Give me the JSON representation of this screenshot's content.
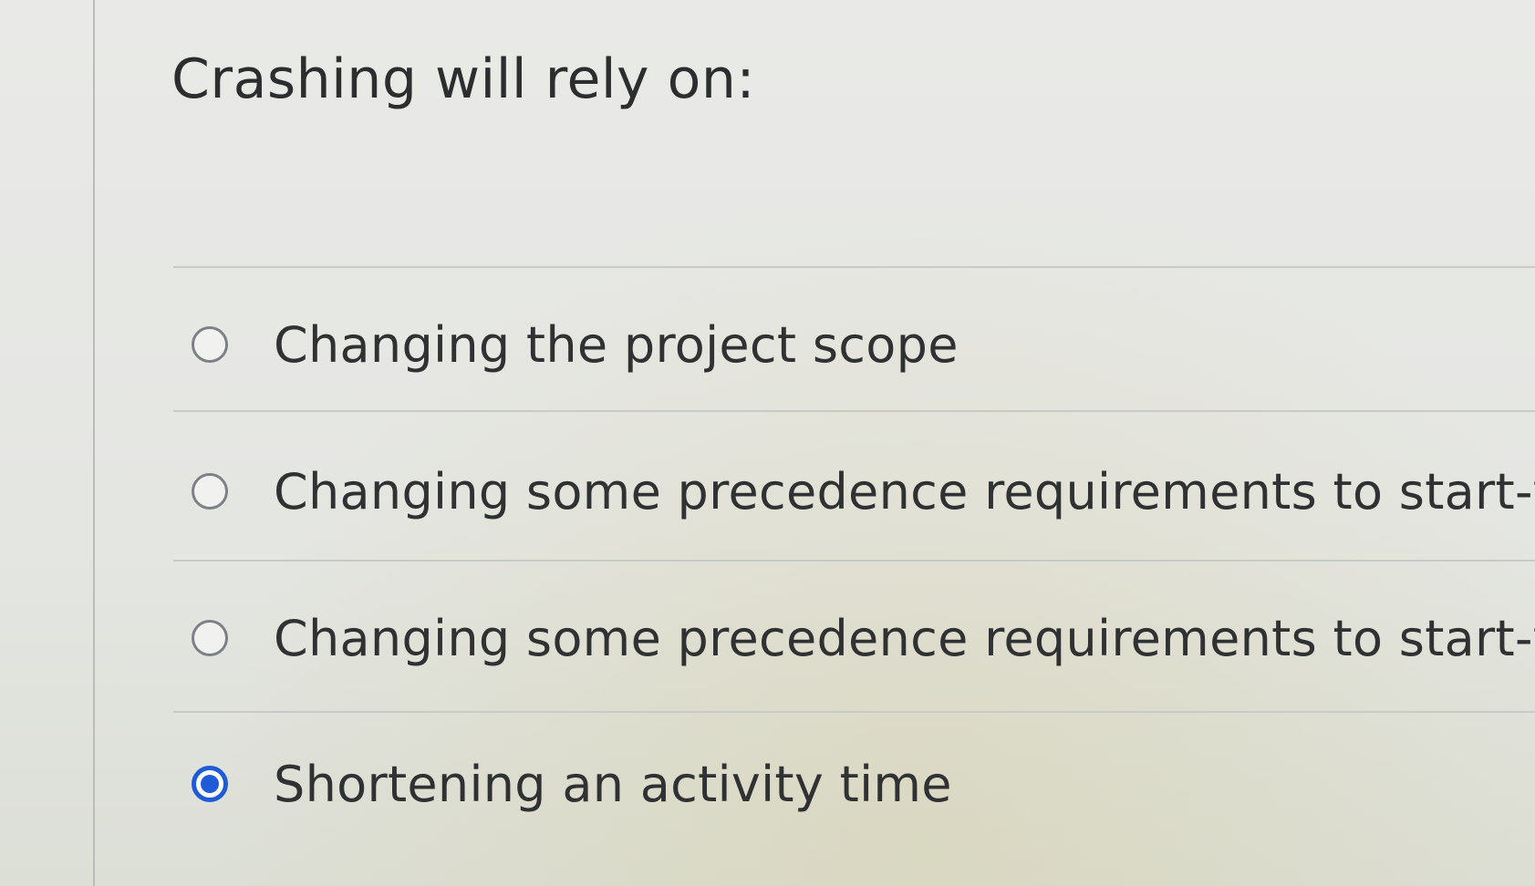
{
  "question": {
    "text": "Crashing will rely on:"
  },
  "answers": [
    {
      "label": "Changing the project scope",
      "selected": false
    },
    {
      "label": "Changing some precedence requirements to start-to s",
      "selected": false
    },
    {
      "label": "Changing some precedence requirements to start-to f",
      "selected": false
    },
    {
      "label": "Shortening an activity time",
      "selected": true
    }
  ],
  "colors": {
    "selected_radio": "#1f5bd8",
    "text": "#2f3133",
    "background": "#e6e8e5"
  }
}
